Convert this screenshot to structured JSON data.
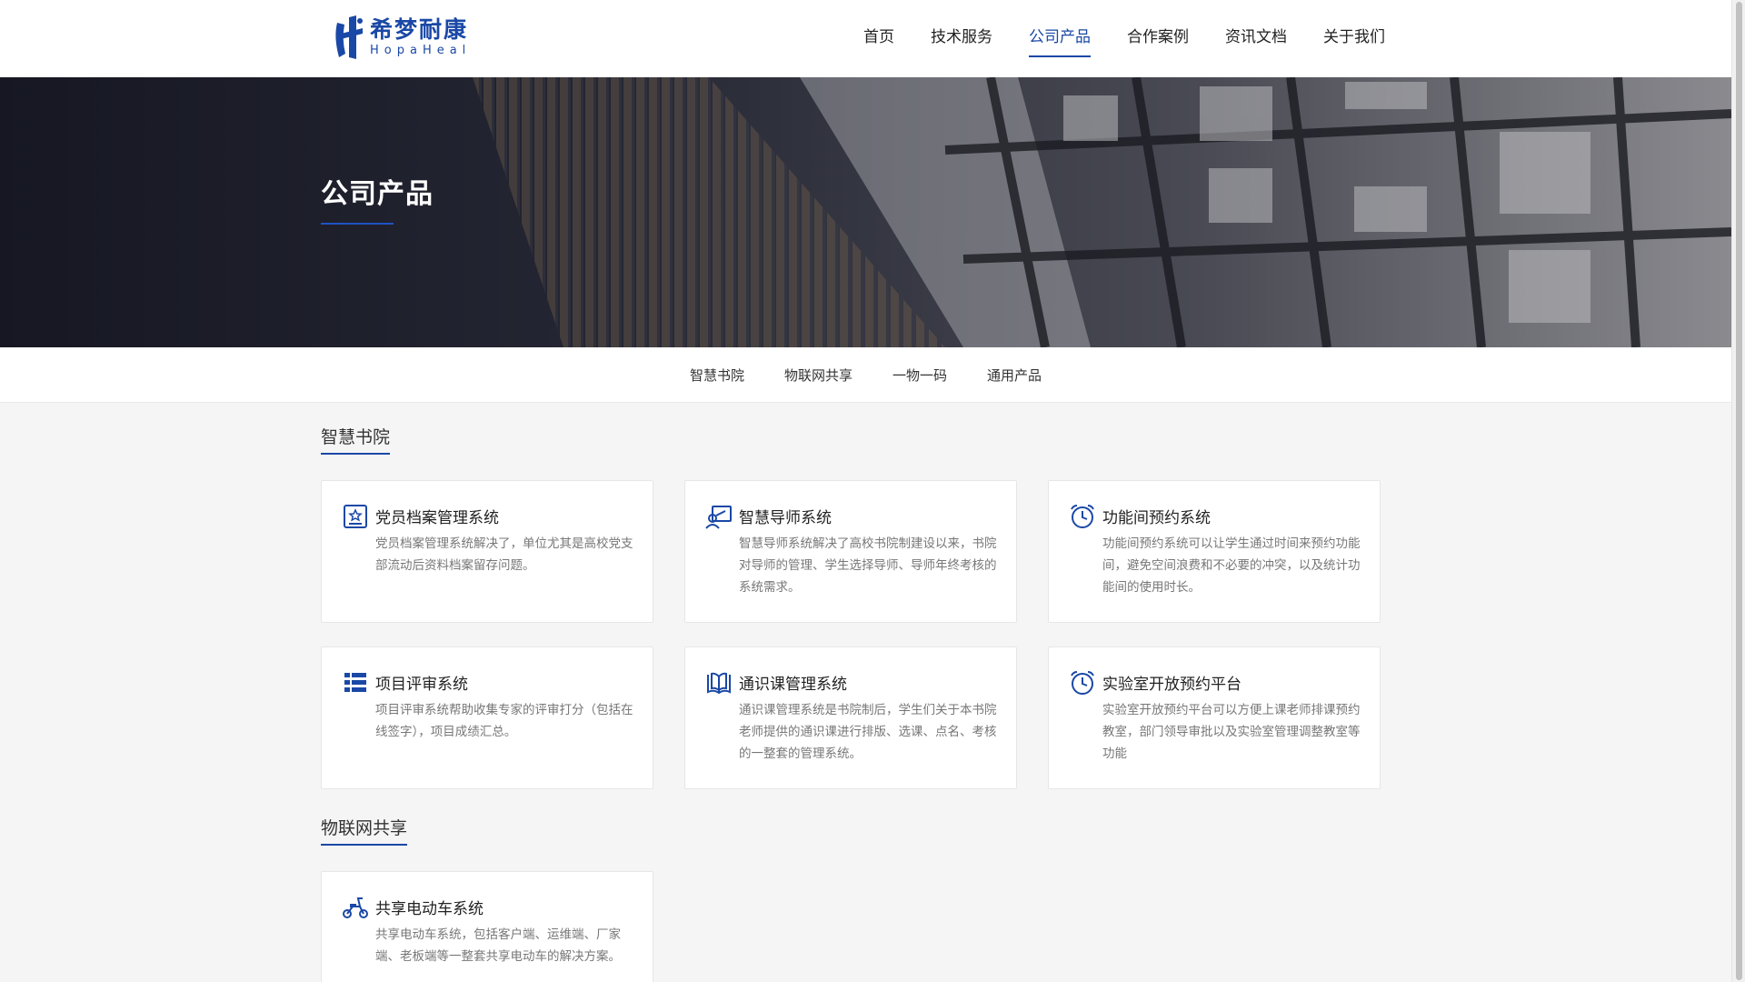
{
  "brand": {
    "name_cn": "希梦耐康",
    "name_en": "HopaHeal",
    "color": "#1a48a6"
  },
  "nav": {
    "items": [
      {
        "label": "首页",
        "active": false
      },
      {
        "label": "技术服务",
        "active": false
      },
      {
        "label": "公司产品",
        "active": true
      },
      {
        "label": "合作案例",
        "active": false
      },
      {
        "label": "资讯文档",
        "active": false
      },
      {
        "label": "关于我们",
        "active": false
      }
    ]
  },
  "banner": {
    "title": "公司产品"
  },
  "subnav": {
    "items": [
      "智慧书院",
      "物联网共享",
      "一物一码",
      "通用产品"
    ]
  },
  "sections": [
    {
      "title": "智慧书院",
      "cards": [
        {
          "icon": "party-member-icon",
          "title": "党员档案管理系统",
          "desc": "党员档案管理系统解决了，单位尤其是高校党支部流动后资料档案留存问题。"
        },
        {
          "icon": "mentor-icon",
          "title": "智慧导师系统",
          "desc": "智慧导师系统解决了高校书院制建设以来，书院对导师的管理、学生选择导师、导师年终考核的系统需求。"
        },
        {
          "icon": "alarm-clock-icon",
          "title": "功能间预约系统",
          "desc": "功能间预约系统可以让学生通过时间来预约功能间，避免空间浪费和不必要的冲突，以及统计功能间的使用时长。"
        },
        {
          "icon": "list-icon",
          "title": "项目评审系统",
          "desc": "项目评审系统帮助收集专家的评审打分（包括在线签字），项目成绩汇总。"
        },
        {
          "icon": "book-icon",
          "title": "通识课管理系统",
          "desc": "通识课管理系统是书院制后，学生们关于本书院老师提供的通识课进行排版、选课、点名、考核的一整套的管理系统。"
        },
        {
          "icon": "alarm-clock-icon",
          "title": "实验室开放预约平台",
          "desc": "实验室开放预约平台可以方便上课老师排课预约教室，部门领导审批以及实验室管理调整教室等功能"
        }
      ]
    },
    {
      "title": "物联网共享",
      "cards": [
        {
          "icon": "scooter-icon",
          "title": "共享电动车系统",
          "desc": "共享电动车系统，包括客户端、运维端、厂家端、老板端等一整套共享电动车的解决方案。"
        }
      ]
    }
  ]
}
